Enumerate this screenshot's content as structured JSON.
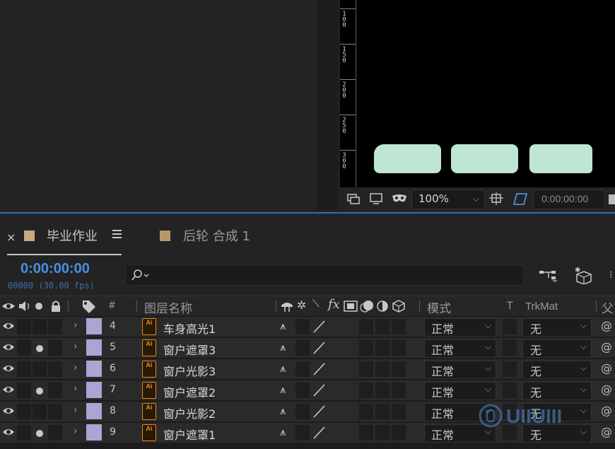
{
  "viewer": {
    "ruler_labels": [
      "100",
      "150",
      "200",
      "250",
      "300"
    ],
    "zoom": "100%",
    "timecode": "0:00:00:00"
  },
  "timeline": {
    "tabs": [
      {
        "label": "毕业作业",
        "color": "#c8a880"
      },
      {
        "label": "后轮 合成 1",
        "color": "#b5996c"
      }
    ],
    "current_time": "0:00:00:00",
    "frames_fps": "00000 (30.00 fps)",
    "columns": {
      "hash": "#",
      "layer_name": "图层名称",
      "mode": "模式",
      "t": "T",
      "trkmat": "TrkMat",
      "parent": "父"
    },
    "layers": [
      {
        "num": "4",
        "name": "车身高光1",
        "mode": "正常",
        "trkmat": "无",
        "visible": true,
        "dot": false
      },
      {
        "num": "5",
        "name": "窗户遮罩3",
        "mode": "正常",
        "trkmat": "无",
        "visible": true,
        "dot": true
      },
      {
        "num": "6",
        "name": "窗户光影3",
        "mode": "正常",
        "trkmat": "无",
        "visible": true,
        "dot": false
      },
      {
        "num": "7",
        "name": "窗户遮罩2",
        "mode": "正常",
        "trkmat": "无",
        "visible": true,
        "dot": true
      },
      {
        "num": "8",
        "name": "窗户光影2",
        "mode": "正常",
        "trkmat": "无",
        "visible": true,
        "dot": false
      },
      {
        "num": "9",
        "name": "窗户遮罩1",
        "mode": "正常",
        "trkmat": "无",
        "visible": true,
        "dot": true
      }
    ],
    "layer_color": "#a9a6d3",
    "file_icon_label": "Ai"
  },
  "colors": {
    "accent_blue": "#4b8fe0",
    "shape_fill": "#bee6d3"
  }
}
